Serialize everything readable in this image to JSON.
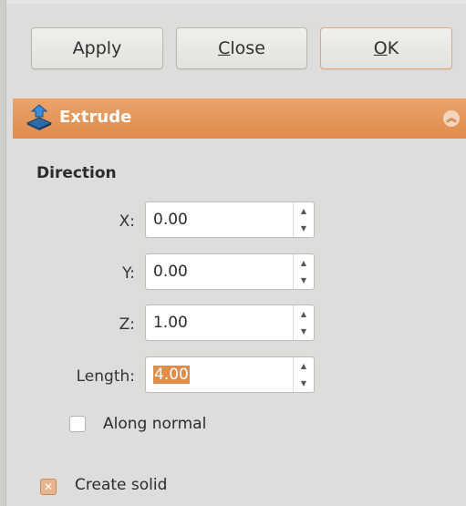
{
  "buttons": {
    "apply": "Apply",
    "close_mnemonic": "C",
    "close_rest": "lose",
    "ok_mnemonic": "O",
    "ok_rest": "K"
  },
  "panel": {
    "title": "Extrude",
    "icon": "extrude-icon",
    "accent_color": "#e29352"
  },
  "direction": {
    "section_label": "Direction",
    "x_label": "X:",
    "x_value": "0.00",
    "y_label": "Y:",
    "y_value": "0.00",
    "z_label": "Z:",
    "z_value": "1.00"
  },
  "length": {
    "label": "Length:",
    "value": "4.00"
  },
  "options": {
    "along_normal_label": "Along normal",
    "along_normal_checked": false,
    "create_solid_label": "Create solid",
    "create_solid_checked": true
  }
}
